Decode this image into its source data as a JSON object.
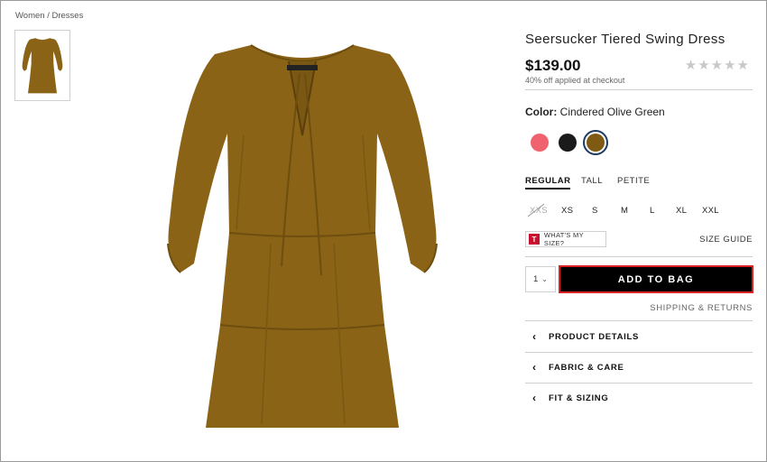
{
  "breadcrumb": {
    "women": "Women",
    "sep": " / ",
    "dresses": "Dresses"
  },
  "product": {
    "title": "Seersucker Tiered Swing Dress",
    "price": "$139.00",
    "promo": "40% off applied at checkout",
    "rating_stars": "★★★★★",
    "color_label": "Color:",
    "color_value": "Cindered Olive Green"
  },
  "swatches": [
    {
      "name": "coral",
      "hex": "#f0626e"
    },
    {
      "name": "black",
      "hex": "#1a1a1a"
    },
    {
      "name": "olive",
      "hex": "#7e5a12",
      "selected": true
    }
  ],
  "size_tabs": [
    "REGULAR",
    "TALL",
    "PETITE"
  ],
  "sizes": [
    "XXS",
    "XS",
    "S",
    "M",
    "L",
    "XL",
    "XXL"
  ],
  "what_my_size": {
    "badge": "T",
    "label": "WHAT'S MY SIZE?"
  },
  "size_guide": "SIZE GUIDE",
  "quantity": {
    "value": "1",
    "chevron": "⌄"
  },
  "add_to_bag": "ADD TO BAG",
  "shipping_returns": "SHIPPING & RETURNS",
  "accordions": [
    "PRODUCT DETAILS",
    "FABRIC & CARE",
    "FIT & SIZING"
  ],
  "colors": {
    "dress": "#8a6316",
    "dress_dark": "#6e4e0f",
    "button": "#000000",
    "highlight": "#dd2222"
  },
  "icons": {
    "chevron_left": "‹",
    "strike": "diagonal-strike-icon",
    "star": "star-icon"
  }
}
